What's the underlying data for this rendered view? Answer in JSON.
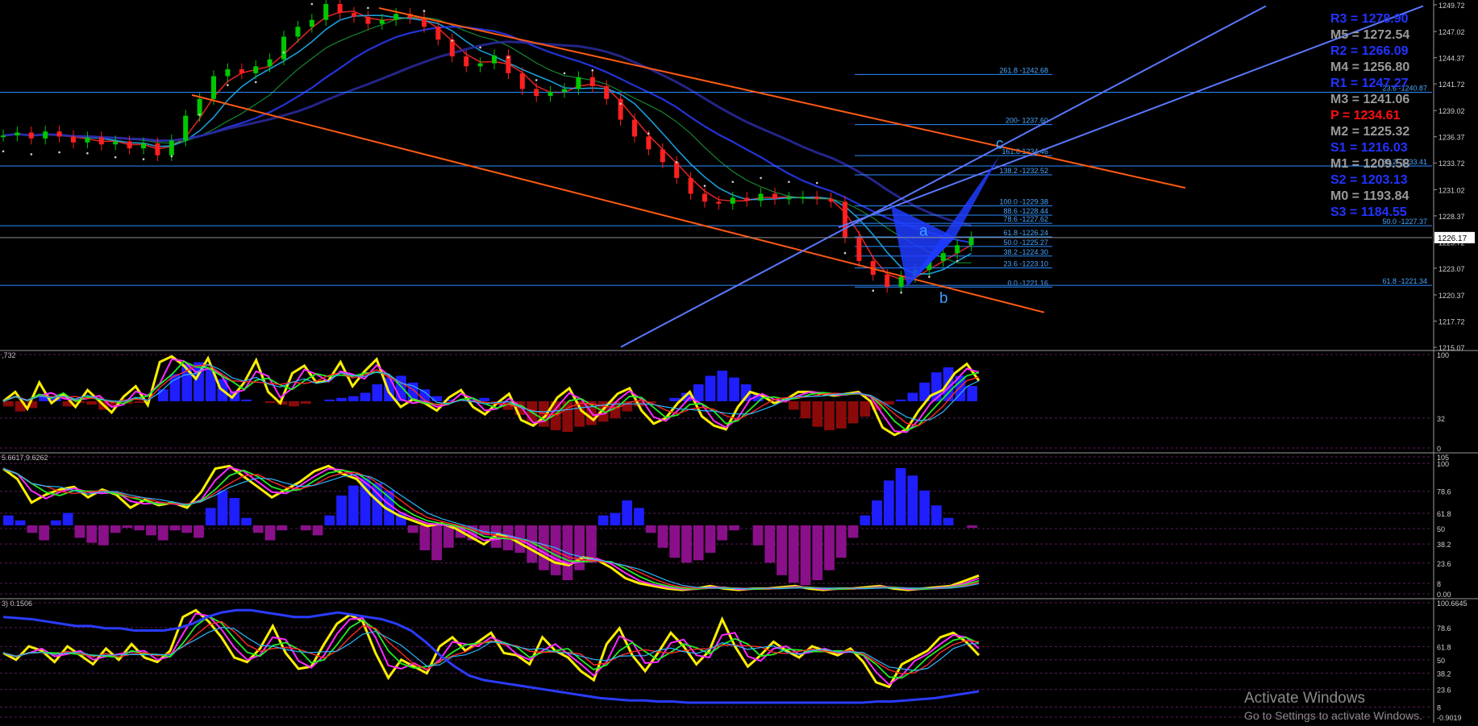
{
  "chart_data": {
    "type": "line",
    "instrument_type": "candlestick",
    "main_panel": {
      "price_axis_ticks": [
        1249.72,
        1247.02,
        1244.37,
        1241.72,
        1239.02,
        1236.37,
        1233.72,
        1231.02,
        1228.37,
        1225.72,
        1223.07,
        1220.37,
        1217.72,
        1215.07
      ],
      "ylim": [
        1215.07,
        1249.72
      ],
      "current_price_label": "1226.17",
      "current_price": 1226.17,
      "colors": {
        "bull_candle": "#00c800",
        "bear_candle": "#ff2020",
        "trend_channel": "#ff5a14",
        "blue_channel": "#5a78ff",
        "horizontal_levels": "#2a8cff",
        "harmonic_pattern": "#1e3cff"
      },
      "price_series": [
        1236.5,
        1236.8,
        1236.2,
        1236.9,
        1236.4,
        1235.8,
        1236.3,
        1235.6,
        1235.9,
        1235.2,
        1235.7,
        1234.5,
        1236,
        1238.5,
        1240.2,
        1242.5,
        1243.2,
        1242.8,
        1243.5,
        1244.2,
        1246.5,
        1247.5,
        1248.2,
        1249.8,
        1248.9,
        1248.5,
        1247.8,
        1248.2,
        1248.8,
        1248.4,
        1247.5,
        1246.2,
        1244.5,
        1243.5,
        1243.8,
        1244.6,
        1242.8,
        1241.2,
        1240.5,
        1240.9,
        1241.2,
        1242.4,
        1241.5,
        1240.2,
        1238.1,
        1236.4,
        1235.1,
        1233.8,
        1232.2,
        1230.6,
        1229.8,
        1229.6,
        1230.2,
        1229.9,
        1230.6,
        1230.1,
        1230.2,
        1230.3,
        1230.1,
        1229.8,
        1226.2,
        1223.8,
        1222.4,
        1221.2,
        1222.2,
        1222.9,
        1223.8,
        1224.6,
        1225.4,
        1226.2
      ],
      "fib_levels_left": [
        {
          "label": "261.8 -1242.68",
          "value": 1242.68
        },
        {
          "label": "200- 1237.60",
          "value": 1237.6
        },
        {
          "label": "161.8 1234.46",
          "value": 1234.46
        },
        {
          "label": "138.2 -1232.52",
          "value": 1232.52
        },
        {
          "label": "100.0 -1229.38",
          "value": 1229.38
        },
        {
          "label": "88.6 -1228.44",
          "value": 1228.44
        },
        {
          "label": "78.6 -1227.62",
          "value": 1227.62
        },
        {
          "label": "61.8 -1226.24",
          "value": 1226.24
        },
        {
          "label": "50.0 -1225.27",
          "value": 1225.27
        },
        {
          "label": "38.2 -1224.30",
          "value": 1224.3
        },
        {
          "label": "23.6 -1223.10",
          "value": 1223.1
        },
        {
          "label": "0.0 -1221.16",
          "value": 1221.16
        }
      ],
      "fib_levels_right": [
        {
          "label": "23.6 -1240.87",
          "value": 1240.87
        },
        {
          "label": "38.2 -1233.41",
          "value": 1233.41
        },
        {
          "label": "50.0 -1227.37",
          "value": 1227.37
        },
        {
          "label": "61.8 -1221.34",
          "value": 1221.34
        }
      ],
      "pattern_points": [
        {
          "label": "a",
          "value": 1226.2
        },
        {
          "label": "b",
          "value": 1221.2
        },
        {
          "label": "c",
          "value": 1234.5
        }
      ],
      "pivots": [
        {
          "label": "R3 = 1278.90",
          "color": "#2233ff"
        },
        {
          "label": "M5 = 1272.54",
          "color": "#9a9a9a"
        },
        {
          "label": "R2 = 1266.09",
          "color": "#2233ff"
        },
        {
          "label": "M4 = 1256.80",
          "color": "#9a9a9a"
        },
        {
          "label": "R1 = 1247.27",
          "color": "#2233ff"
        },
        {
          "label": "M3 = 1241.06",
          "color": "#9a9a9a"
        },
        {
          "label": "P   = 1234.61",
          "color": "#ff1010"
        },
        {
          "label": "M2 = 1225.32",
          "color": "#9a9a9a"
        },
        {
          "label": "S1 = 1216.03",
          "color": "#2233ff"
        },
        {
          "label": "M1 = 1209.58",
          "color": "#9a9a9a"
        },
        {
          "label": "S2 = 1203.13",
          "color": "#2233ff"
        },
        {
          "label": "M0 = 1193.84",
          "color": "#9a9a9a"
        },
        {
          "label": "S3 = 1184.55",
          "color": "#2233ff"
        }
      ]
    },
    "sub_panels": [
      {
        "name_label": ",732",
        "ticks": [
          "100",
          "32",
          "0"
        ],
        "tick_values": [
          100,
          32,
          0
        ],
        "ylim": [
          0,
          100
        ],
        "series": {
          "histogram": [
            -6,
            -12,
            -8,
            8,
            5,
            -6,
            -2,
            -4,
            -10,
            -6,
            -3,
            -2,
            0,
            14,
            32,
            44,
            46,
            38,
            26,
            12,
            2,
            0,
            -2,
            -4,
            -6,
            -3,
            0,
            2,
            4,
            6,
            10,
            20,
            28,
            30,
            22,
            14,
            6,
            2,
            0,
            2,
            4,
            -4,
            -10,
            -16,
            -24,
            -30,
            -34,
            -36,
            -30,
            -28,
            -24,
            -20,
            -12,
            -6,
            -2,
            0,
            4,
            10,
            20,
            30,
            36,
            28,
            20,
            8,
            0,
            -2,
            -10,
            -20,
            -30,
            -34,
            -32,
            -26,
            -18,
            -10,
            -4,
            2,
            10,
            22,
            34,
            40,
            30,
            18
          ],
          "oscillator": [
            50,
            60,
            42,
            70,
            48,
            58,
            44,
            62,
            50,
            38,
            55,
            66,
            46,
            92,
            98,
            88,
            74,
            96,
            64,
            54,
            70,
            94,
            60,
            48,
            80,
            88,
            70,
            72,
            92,
            66,
            82,
            95,
            60,
            44,
            52,
            48,
            40,
            54,
            62,
            44,
            36,
            48,
            58,
            30,
            24,
            34,
            54,
            64,
            40,
            30,
            44,
            58,
            64,
            40,
            26,
            32,
            48,
            60,
            34,
            24,
            20,
            44,
            60,
            56,
            48,
            52,
            60,
            60,
            58,
            56,
            58,
            60,
            50,
            22,
            14,
            20,
            40,
            56,
            62,
            80,
            90,
            72
          ]
        }
      },
      {
        "name_label": "5.6617,9.6262",
        "ticks": [
          "105",
          "100",
          "78.6",
          "61.8",
          "50",
          "38.2",
          "23.6",
          "8",
          "0.00"
        ],
        "tick_values": [
          105,
          100,
          78.6,
          61.8,
          50,
          38.2,
          23.6,
          8,
          0
        ],
        "ylim": [
          0,
          105
        ],
        "series": {
          "histogram": [
            8,
            4,
            -6,
            -12,
            4,
            10,
            -10,
            -14,
            -16,
            -6,
            -2,
            -4,
            -8,
            -12,
            -4,
            -6,
            -10,
            14,
            28,
            22,
            6,
            -6,
            -12,
            -4,
            0,
            -4,
            -8,
            8,
            24,
            32,
            38,
            34,
            28,
            10,
            -6,
            -20,
            -28,
            -18,
            -10,
            -12,
            -8,
            -18,
            -20,
            -22,
            -30,
            -36,
            -40,
            -44,
            -36,
            -30,
            8,
            10,
            20,
            14,
            -6,
            -18,
            -26,
            -30,
            -28,
            -22,
            -12,
            -4,
            0,
            -16,
            -30,
            -40,
            -46,
            -48,
            -44,
            -36,
            -26,
            -10,
            8,
            20,
            36,
            46,
            40,
            28,
            16,
            6,
            0,
            -2
          ],
          "oscillator": [
            96,
            88,
            70,
            76,
            80,
            82,
            74,
            80,
            76,
            66,
            72,
            68,
            70,
            66,
            78,
            96,
            98,
            90,
            82,
            74,
            80,
            86,
            94,
            98,
            92,
            88,
            76,
            66,
            60,
            56,
            52,
            54,
            50,
            44,
            38,
            46,
            42,
            36,
            30,
            24,
            22,
            28,
            26,
            20,
            12,
            8,
            6,
            4,
            3,
            4,
            6,
            4,
            3,
            4,
            4,
            5,
            6,
            4,
            3,
            4,
            4,
            5,
            6,
            4,
            3,
            4,
            5,
            6,
            10,
            14
          ]
        }
      },
      {
        "name_label": "3) 0.1506",
        "ticks": [
          "100.6645",
          "78.6",
          "61.8",
          "50",
          "38.2",
          "23.6",
          "8",
          "-0.9019"
        ],
        "tick_values": [
          100.6645,
          78.6,
          61.8,
          50,
          38.2,
          23.6,
          8,
          -0.9019
        ],
        "ylim": [
          -0.9019,
          100.6645
        ],
        "series": {
          "oscillator": [
            56,
            50,
            62,
            58,
            48,
            62,
            54,
            46,
            60,
            50,
            64,
            52,
            48,
            58,
            88,
            94,
            84,
            70,
            52,
            48,
            60,
            80,
            56,
            42,
            44,
            64,
            82,
            90,
            84,
            56,
            34,
            50,
            44,
            38,
            62,
            70,
            58,
            66,
            74,
            56,
            54,
            46,
            70,
            58,
            52,
            40,
            32,
            64,
            78,
            54,
            40,
            56,
            74,
            62,
            46,
            58,
            86,
            62,
            44,
            54,
            66,
            58,
            52,
            62,
            58,
            54,
            60,
            48,
            30,
            26,
            46,
            52,
            58,
            70,
            74,
            66,
            54
          ],
          "slow_line": [
            88,
            87,
            86,
            84,
            82,
            80,
            80,
            78,
            78,
            76,
            76,
            76,
            78,
            82,
            88,
            92,
            94,
            94,
            92,
            90,
            88,
            88,
            90,
            92,
            90,
            88,
            86,
            82,
            76,
            66,
            54,
            44,
            36,
            32,
            30,
            28,
            26,
            24,
            22,
            20,
            18,
            16,
            15,
            14,
            14,
            13,
            13,
            12,
            12,
            12,
            12,
            12,
            12,
            12,
            12,
            12,
            12,
            12,
            12,
            12,
            13,
            13,
            14,
            15,
            16,
            18,
            20,
            22
          ]
        }
      }
    ]
  },
  "watermark": {
    "title": "Activate Windows",
    "subtitle": "Go to Settings to activate Windows."
  }
}
